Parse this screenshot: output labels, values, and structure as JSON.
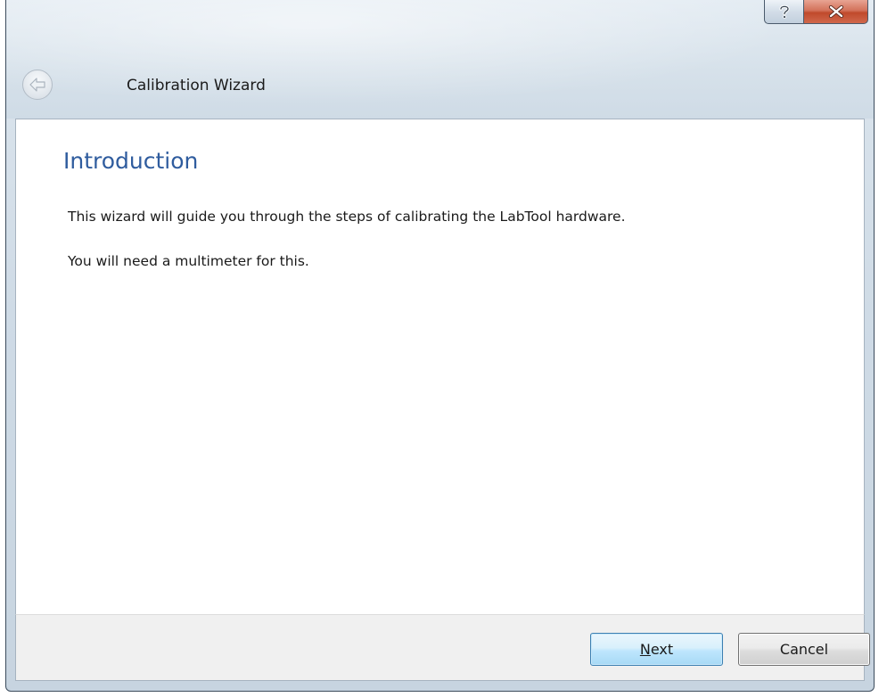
{
  "window": {
    "title": "Calibration Wizard"
  },
  "caption_buttons": {
    "help_icon": "help-question-icon",
    "close_icon": "close-x-icon",
    "close_color": "#c7502f"
  },
  "navigation": {
    "back_icon": "back-arrow-icon"
  },
  "page": {
    "heading": "Introduction",
    "heading_color": "#2f5c9e",
    "paragraphs": [
      "This wizard will guide you through the steps of calibrating the LabTool hardware.",
      "You will need a multimeter for this."
    ]
  },
  "footer": {
    "next_accel": "N",
    "next_rest": "ext",
    "cancel_label": "Cancel"
  }
}
